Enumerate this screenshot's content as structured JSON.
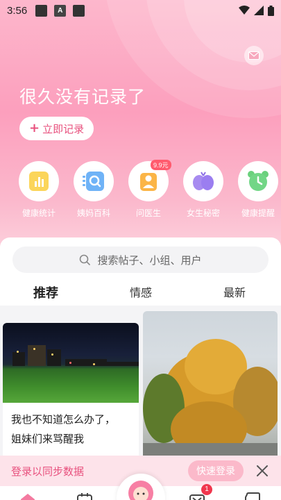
{
  "status_bar": {
    "time": "3:56"
  },
  "hero": {
    "title": "很久没有记录了",
    "record_button": "立即记录"
  },
  "features": [
    {
      "label": "健康统计",
      "icon": "chart-icon"
    },
    {
      "label": "姨妈百科",
      "icon": "search-book-icon"
    },
    {
      "label": "问医生",
      "icon": "doctor-icon",
      "badge": "9.9元"
    },
    {
      "label": "女生秘密",
      "icon": "heart-fruit-icon"
    },
    {
      "label": "健康提醒",
      "icon": "alarm-clock-icon"
    }
  ],
  "search": {
    "placeholder": "搜索帖子、小组、用户"
  },
  "tabs": [
    {
      "label": "推荐",
      "active": true
    },
    {
      "label": "情感",
      "active": false
    },
    {
      "label": "最新",
      "active": false
    }
  ],
  "feed": {
    "posts": [
      {
        "text_line1": "我也不知道怎么办了，",
        "text_line2": "姐妹们来骂醒我"
      }
    ]
  },
  "login_banner": {
    "text": "登录以同步数据",
    "button": "快速登录"
  },
  "bottom_nav": {
    "message_badge": "1"
  },
  "colors": {
    "accent": "#e8517e",
    "hero_pink": "#fc9fbd",
    "banner_bg": "#fde3ea"
  }
}
